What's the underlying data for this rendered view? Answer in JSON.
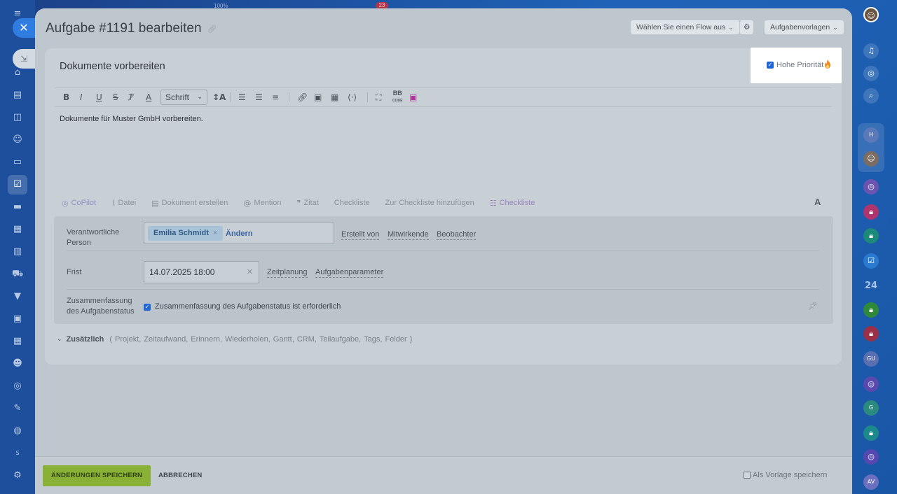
{
  "topbar": {
    "zoom": "100%",
    "badge": "23"
  },
  "rail_right": {
    "counter": "24",
    "avatars": [
      "H",
      "GU",
      "G",
      "AV"
    ]
  },
  "rail_left": {
    "user_initial": "S"
  },
  "header": {
    "title": "Aufgabe #1191 bearbeiten",
    "flow_select": "Wählen Sie einen Flow aus",
    "templates_btn": "Aufgabenvorlagen"
  },
  "task": {
    "title": "Dokumente vorbereiten",
    "priority_label": "Hohe Priorität",
    "priority_checked": true,
    "description": "Dokumente für Muster GmbH vorbereiten."
  },
  "toolbar": {
    "font_select": "Schrift",
    "bb_label": "BB",
    "bb_sub": "CODE"
  },
  "actions": {
    "copilot": "CoPilot",
    "file": "Datei",
    "create_doc": "Dokument erstellen",
    "mention": "Mention",
    "quote": "Zitat",
    "checklist": "Checkliste",
    "add_to_checklist": "Zur Checkliste hinzufügen",
    "checklist2": "Checkliste",
    "font_toggle": "A"
  },
  "fields": {
    "responsible_label_1": "Verantwortliche",
    "responsible_label_2": "Person",
    "responsible_person": "Emilia Schmidt",
    "change": "Ändern",
    "created_by": "Erstellt von",
    "participants": "Mitwirkende",
    "observers": "Beobachter",
    "deadline_label": "Frist",
    "deadline_value": "14.07.2025 18:00",
    "planning": "Zeitplanung",
    "task_params": "Aufgabenparameter",
    "summary_label_1": "Zusammenfassung",
    "summary_label_2": "des Aufgabenstatus",
    "summary_text": "Zusammenfassung des Aufgabenstatus ist erforderlich"
  },
  "extra": {
    "title": "Zusätzlich",
    "open_paren": "(",
    "items": [
      "Projekt,",
      "Zeitaufwand,",
      "Erinnern,",
      "Wiederholen,",
      "Gantt,",
      "CRM,",
      "Teilaufgabe,",
      "Tags,",
      "Felder"
    ],
    "close_paren": ")"
  },
  "footer": {
    "save": "ÄNDERUNGEN SPEICHERN",
    "cancel": "ABBRECHEN",
    "save_template": "Als Vorlage speichern"
  },
  "colors": {
    "accent_blue": "#2266d6",
    "save_green": "#88b136",
    "fire_orange": "#f08a24",
    "rail_blue": "#1d4f9c"
  }
}
